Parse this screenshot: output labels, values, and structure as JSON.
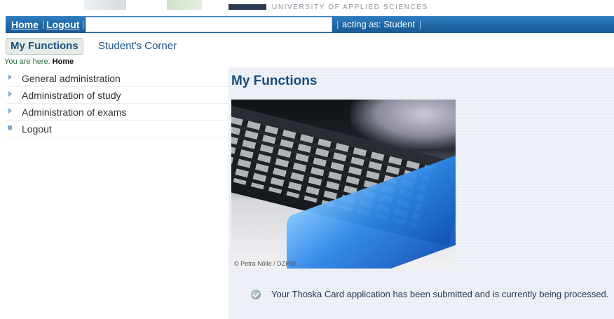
{
  "banner": {
    "university_text": "UNIVERSITY OF APPLIED SCIENCES"
  },
  "navbar": {
    "home_label": "Home",
    "logout_label": "Logout",
    "acting_as": "acting as: Student"
  },
  "tabs": [
    {
      "label": "My Functions",
      "active": true
    },
    {
      "label": "Student's Corner",
      "active": false
    }
  ],
  "breadcrumb": {
    "prefix": "You are here: ",
    "current": "Home"
  },
  "menu": {
    "items": [
      {
        "label": "General administration",
        "icon": "triangle-bullet-icon"
      },
      {
        "label": "Administration of study",
        "icon": "triangle-bullet-icon"
      },
      {
        "label": "Administration of exams",
        "icon": "triangle-bullet-icon"
      },
      {
        "label": "Logout",
        "icon": "square-bullet-icon"
      }
    ]
  },
  "main": {
    "title": "My Functions",
    "image_credit": "© Petra Nölle / DZHW",
    "notice": "Your Thoska Card application has been submitted and is currently being processed."
  },
  "colors": {
    "navbar": "#1f66a6",
    "title": "#134d80",
    "panel": "#eef1f7"
  }
}
